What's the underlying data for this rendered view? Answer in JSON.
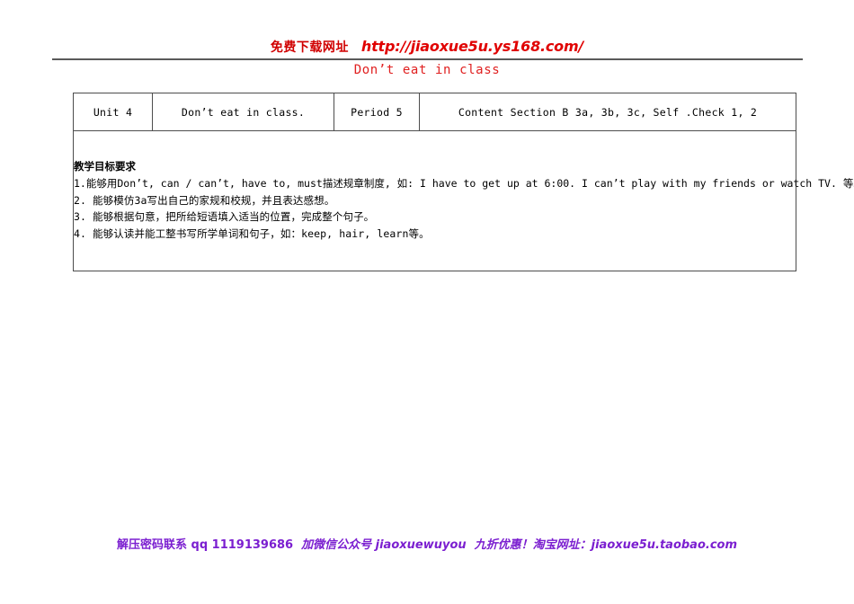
{
  "promo_header": {
    "label_cn": "免费下载网址",
    "url": "http://jiaoxue5u.ys168.com/",
    "color": "#d00000"
  },
  "document": {
    "title": "Don’t eat in class",
    "title_color": "#e02020"
  },
  "table": {
    "header_row": {
      "unit": "Unit 4",
      "topic": "Don’t eat in class.",
      "period": "Period 5",
      "content": "Content  Section B  3a, 3b, 3c, Self .Check 1, 2"
    },
    "body": {
      "heading": "教学目标要求",
      "objectives": [
        "1.能够用Don’t, can / can’t, have to, must描述规章制度, 如: I have to get up at 6:00.  I can’t play with my friends or watch TV.  等。",
        "2. 能够模仿3a写出自己的家规和校规，并且表达感想。",
        "3. 能够根据句意，把所给短语填入适当的位置，完成整个句子。",
        "4. 能够认读并能工整书写所学单词和句子，如：keep, hair, learn等。"
      ]
    }
  },
  "promo_footer": {
    "segments": [
      "解压密码联系 qq 1119139686",
      "加微信公众号 jiaoxuewuyou",
      "九折优惠！淘宝网址：jiaoxue5u.taobao.com"
    ],
    "color": "#7b1fd0"
  }
}
